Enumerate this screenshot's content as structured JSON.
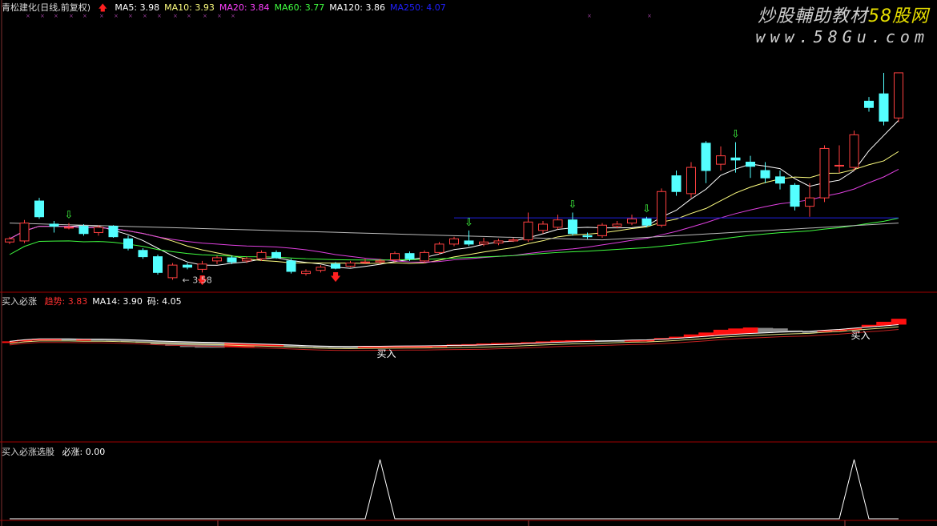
{
  "main_panel": {
    "stock_name": "青松建化(日线,前复权)",
    "indicators": [
      {
        "label": "MA5: 3.98",
        "color": "#ffffff"
      },
      {
        "label": "MA10: 3.93",
        "color": "#ffff80"
      },
      {
        "label": "MA20: 3.84",
        "color": "#ff40ff"
      },
      {
        "label": "MA60: 3.77",
        "color": "#40ff40"
      },
      {
        "label": "MA120: 3.86",
        "color": "#ffffff"
      },
      {
        "label": "MA250: 4.07",
        "color": "#2020ff"
      }
    ],
    "low_marker": "3.58"
  },
  "mid_panel": {
    "title": "买入必涨",
    "indicators": [
      {
        "label": "趋势: 3.83",
        "color": "#ff3030"
      },
      {
        "label": "MA14: 3.90",
        "color": "#ffffff"
      },
      {
        "label": "码: 4.05",
        "color": "#ffffff"
      }
    ],
    "signal_label": "买入"
  },
  "bottom_panel": {
    "title": "买入必涨选股",
    "indicators": [
      {
        "label": "必涨: 0.00",
        "color": "#ffffff"
      }
    ]
  },
  "watermark": {
    "line1": "炒股輔助教材",
    "line1_brand": "58股网",
    "line2": "www.58Gu.com"
  },
  "colors": {
    "up": "#ff4040",
    "down": "#54ffff",
    "ma5": "#ffffff",
    "ma10": "#ffff80",
    "ma20": "#e040e0",
    "ma60": "#40ff40",
    "ma120": "#ffffff",
    "ma250": "#2020e0",
    "divider": "#a00000"
  },
  "chart_data": {
    "type": "candlestick",
    "ylim": [
      3.5,
      5.9
    ],
    "ohlc": [
      [
        3.94,
        3.97,
        3.99,
        3.92
      ],
      [
        3.95,
        4.12,
        4.15,
        3.93
      ],
      [
        4.33,
        4.18,
        4.36,
        4.16
      ],
      [
        4.11,
        4.09,
        4.14,
        4.03
      ],
      [
        4.08,
        4.08,
        4.12,
        4.06
      ],
      [
        4.09,
        4.02,
        4.11,
        4.0
      ],
      [
        4.03,
        4.08,
        4.1,
        4.0
      ],
      [
        4.09,
        3.99,
        4.1,
        3.98
      ],
      [
        3.97,
        3.88,
        4.0,
        3.86
      ],
      [
        3.86,
        3.8,
        3.88,
        3.78
      ],
      [
        3.8,
        3.65,
        3.82,
        3.63
      ],
      [
        3.6,
        3.72,
        3.74,
        3.58
      ],
      [
        3.72,
        3.7,
        3.74,
        3.68
      ],
      [
        3.68,
        3.73,
        3.76,
        3.65
      ],
      [
        3.76,
        3.79,
        3.81,
        3.73
      ],
      [
        3.79,
        3.75,
        3.81,
        3.73
      ],
      [
        3.76,
        3.78,
        3.8,
        3.74
      ],
      [
        3.78,
        3.84,
        3.86,
        3.76
      ],
      [
        3.84,
        3.79,
        3.86,
        3.78
      ],
      [
        3.76,
        3.66,
        3.78,
        3.64
      ],
      [
        3.64,
        3.66,
        3.68,
        3.62
      ],
      [
        3.67,
        3.7,
        3.72,
        3.65
      ],
      [
        3.73,
        3.69,
        3.75,
        3.68
      ],
      [
        3.71,
        3.74,
        3.76,
        3.7
      ],
      [
        3.75,
        3.75,
        3.78,
        3.73
      ],
      [
        3.75,
        3.76,
        3.78,
        3.73
      ],
      [
        3.77,
        3.83,
        3.85,
        3.75
      ],
      [
        3.83,
        3.78,
        3.85,
        3.76
      ],
      [
        3.76,
        3.84,
        3.86,
        3.74
      ],
      [
        3.84,
        3.92,
        3.94,
        3.82
      ],
      [
        3.92,
        3.97,
        3.99,
        3.9
      ],
      [
        3.95,
        3.92,
        4.05,
        3.9
      ],
      [
        3.92,
        3.94,
        3.98,
        3.9
      ],
      [
        3.93,
        3.95,
        3.97,
        3.91
      ],
      [
        3.95,
        3.96,
        3.98,
        3.94
      ],
      [
        3.96,
        4.13,
        4.22,
        3.94
      ],
      [
        4.05,
        4.11,
        4.14,
        4.02
      ],
      [
        4.08,
        4.15,
        4.2,
        4.06
      ],
      [
        4.15,
        4.02,
        4.22,
        4.0
      ],
      [
        4.0,
        3.99,
        4.03,
        3.97
      ],
      [
        4.0,
        4.1,
        4.12,
        3.98
      ],
      [
        4.09,
        4.11,
        4.14,
        4.07
      ],
      [
        4.12,
        4.16,
        4.2,
        4.1
      ],
      [
        4.16,
        4.1,
        4.18,
        4.08
      ],
      [
        4.1,
        4.42,
        4.45,
        4.08
      ],
      [
        4.57,
        4.42,
        4.62,
        4.38
      ],
      [
        4.4,
        4.65,
        4.7,
        4.36
      ],
      [
        4.88,
        4.62,
        4.9,
        4.5
      ],
      [
        4.68,
        4.76,
        4.85,
        4.62
      ],
      [
        4.74,
        4.72,
        4.89,
        4.6
      ],
      [
        4.7,
        4.66,
        4.76,
        4.55
      ],
      [
        4.62,
        4.55,
        4.7,
        4.5
      ],
      [
        4.56,
        4.5,
        4.62,
        4.44
      ],
      [
        4.48,
        4.28,
        4.5,
        4.24
      ],
      [
        4.28,
        4.36,
        4.5,
        4.18
      ],
      [
        4.36,
        4.83,
        4.86,
        4.32
      ],
      [
        4.67,
        4.67,
        4.86,
        4.6
      ],
      [
        4.65,
        4.96,
        5.0,
        4.62
      ],
      [
        5.28,
        5.22,
        5.32,
        5.18
      ],
      [
        5.35,
        5.09,
        5.55,
        5.05
      ],
      [
        5.12,
        5.55,
        5.55,
        5.08
      ]
    ],
    "buy_arrows": [
      4,
      31,
      38,
      43,
      49
    ],
    "sell_arrows": [
      13,
      22
    ],
    "low_index": 11,
    "ma250_value": 4.07,
    "ma250_start": 30,
    "buy_signals": [
      25,
      57
    ],
    "bottom_ylim": [
      0,
      1
    ]
  }
}
